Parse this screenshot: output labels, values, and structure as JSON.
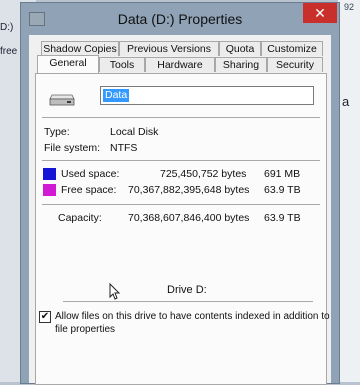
{
  "background": {
    "left_drive": "D:)",
    "left_text": "free of",
    "right_text_top": "92",
    "right_text_mid": "a"
  },
  "window": {
    "title": "Data (D:) Properties",
    "close_glyph": "✕"
  },
  "tabs": {
    "row1": [
      "Shadow Copies",
      "Previous Versions",
      "Quota",
      "Customize"
    ],
    "row2": [
      "General",
      "Tools",
      "Hardware",
      "Sharing",
      "Security"
    ],
    "active": "General"
  },
  "general": {
    "name_value": "Data",
    "type_label": "Type:",
    "type_value": "Local Disk",
    "fs_label": "File system:",
    "fs_value": "NTFS",
    "used_label": "Used space:",
    "used_bytes": "725,450,752 bytes",
    "used_size": "691 MB",
    "free_label": "Free space:",
    "free_bytes": "70,367,882,395,648 bytes",
    "free_size": "63.9 TB",
    "capacity_label": "Capacity:",
    "capacity_bytes": "70,368,607,846,400 bytes",
    "capacity_size": "63.9 TB",
    "drive_label": "Drive D:",
    "index_label_line1": "Allow files on this drive to have contents indexed in addition to",
    "index_label_line2": "file properties",
    "index_checked": true,
    "check_glyph": "✔"
  },
  "colors": {
    "used": "#1515d6",
    "free": "#d01ad4",
    "free_shadow": "#6a0f71",
    "accent_selection": "#3399ff"
  }
}
